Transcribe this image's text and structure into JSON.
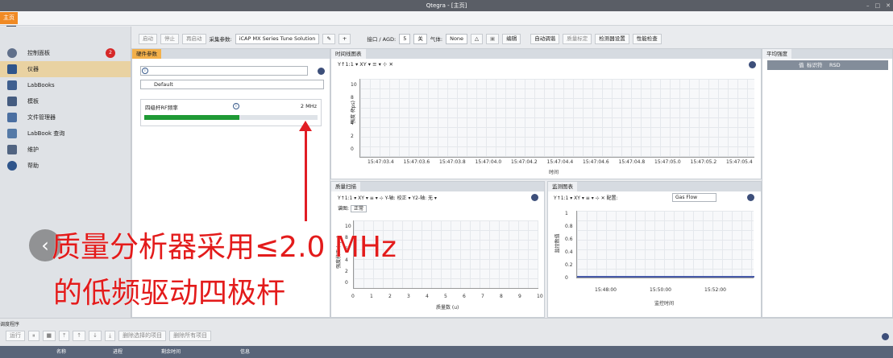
{
  "window": {
    "title": "Qtegra - [主页]",
    "home_tab": "主页"
  },
  "sidebar": {
    "items": [
      {
        "label": "控制面板",
        "badge": "2",
        "icon": "dashboard-icon"
      },
      {
        "label": "仪器",
        "icon": "instrument-icon"
      },
      {
        "label": "LabBooks",
        "icon": "book-icon"
      },
      {
        "label": "模板",
        "icon": "template-icon"
      },
      {
        "label": "文件管理器",
        "icon": "folder-icon"
      },
      {
        "label": "LabBook 查询",
        "icon": "search-folder-icon"
      },
      {
        "label": "维护",
        "icon": "tools-icon"
      },
      {
        "label": "帮助",
        "icon": "help-icon"
      }
    ]
  },
  "toolbar": {
    "start": "启动",
    "stop": "停止",
    "standby": "再启动",
    "params_label": "采集参数:",
    "params_value": "iCAP MX Series Tune Solution",
    "port_label": "接口 / AGD:",
    "port_value": "5",
    "port_unit": "关",
    "gas_label": "气体:",
    "gas_value": "None",
    "edit": "编辑",
    "autotune": "自动调谐",
    "quality": "质量标定",
    "detector": "检测器设置",
    "performance": "性能检查"
  },
  "hardware_panel": {
    "tab": "硬件参数",
    "profile": "Default",
    "rf_label": "四级杆RF频率",
    "rf_value": "2 MHz",
    "progress": 0.55
  },
  "timeseries_panel": {
    "tab": "时间线图表",
    "controls": "Y↑1:1 ▾ XY ▾ ≡ ▾ ⊹ ✕",
    "yaxis": "强度 (cps)",
    "xaxis": "时间",
    "yticks": [
      "10",
      "8",
      "6",
      "4",
      "2",
      "0"
    ],
    "xticks": [
      "15:47:03.4",
      "15:47:03.6",
      "15:47:03.8",
      "15:47:04.0",
      "15:47:04.2",
      "15:47:04.4",
      "15:47:04.6",
      "15:47:04.8",
      "15:47:05.0",
      "15:47:05.2",
      "15:47:05.4"
    ]
  },
  "average_panel": {
    "tab": "平均强度",
    "col_value": "值",
    "col_id": "标识符",
    "col_rsd": "RSD"
  },
  "spectrum_panel": {
    "tab": "质量扫描",
    "controls": "Y↑1:1 ▾ XY ▾ ≡ ▾ ⊹ Y-轴: 校正 ▾ Y2-轴: 无 ▾",
    "mode_label": "谱图:",
    "mode_value": "正常",
    "yaxis": "强度校正 (cps)",
    "xaxis": "质量数 (u)",
    "yticks": [
      "10",
      "8",
      "6",
      "4",
      "2",
      "0"
    ],
    "xticks": [
      "0",
      "1",
      "2",
      "3",
      "4",
      "5",
      "6",
      "7",
      "8",
      "9",
      "10"
    ]
  },
  "monitor_panel": {
    "tab": "监测图表",
    "controls": "Y↑1:1 ▾ XY ▾ ≡ ▾ ⊹ ✕ 配置:",
    "config_value": "Gas Flow",
    "yaxis": "监控数值",
    "xaxis": "监控时间",
    "yticks": [
      "1",
      "0.8",
      "0.6",
      "0.4",
      "0.2",
      "0"
    ],
    "xticks": [
      "15:48:00",
      "15:50:00",
      "15:52:00"
    ]
  },
  "bottom": {
    "title": "调度程序",
    "run": "运行",
    "remove_selected": "删除选择的项目",
    "remove_all": "删除所有项目",
    "cols": [
      "名称",
      "进程",
      "剩余时间",
      "信息"
    ]
  },
  "caption": {
    "line1": "质量分析器采用≤2.0 MHz",
    "line2": "的低频驱动四极杆"
  },
  "colors": {
    "accent": "#f3b04a",
    "progress": "#1f9a35",
    "arrow": "#e11d24"
  }
}
